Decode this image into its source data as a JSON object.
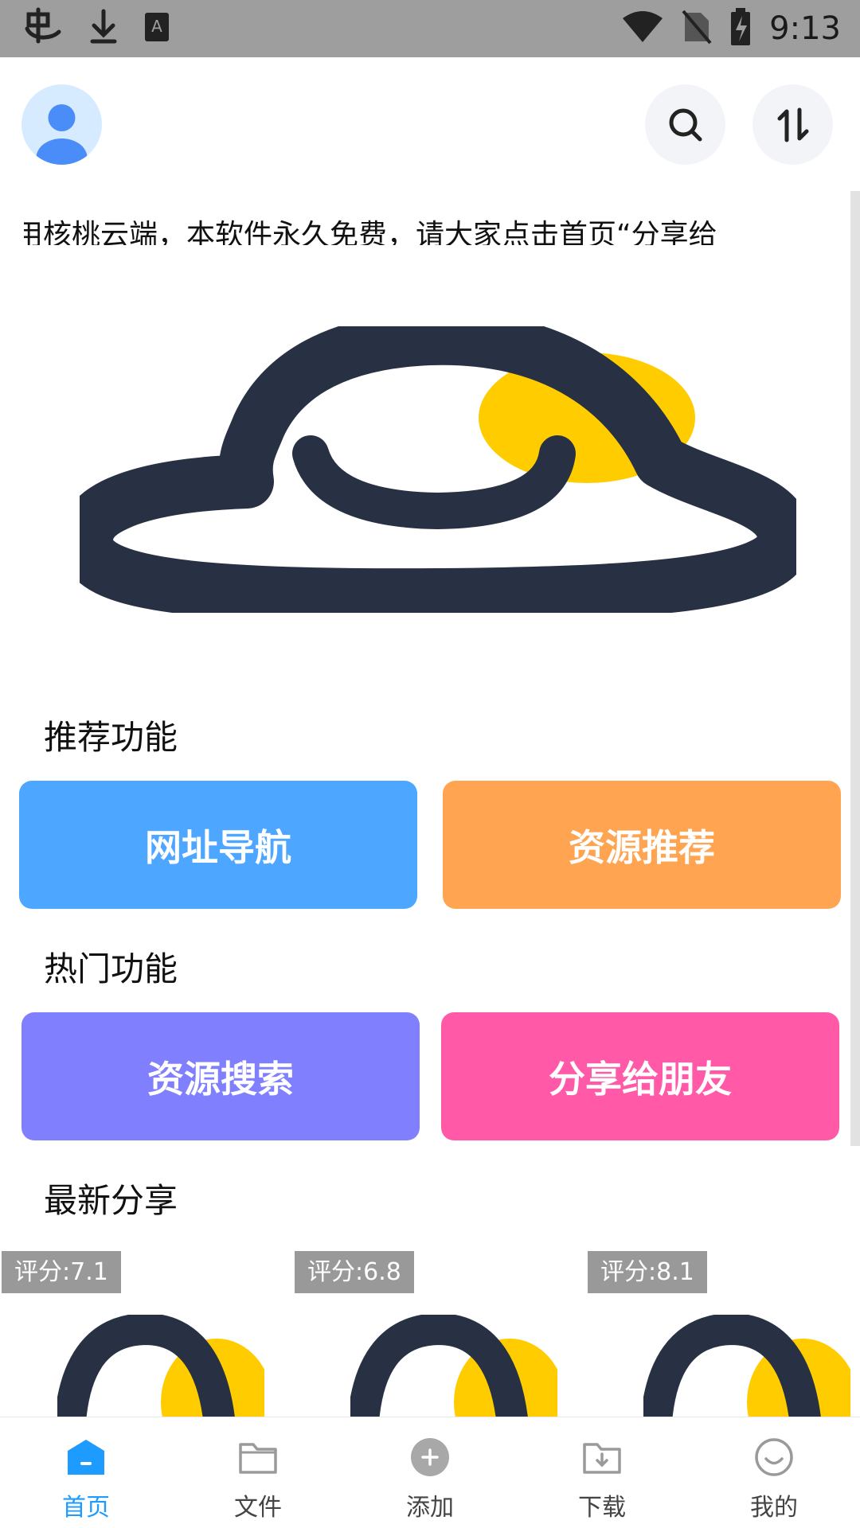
{
  "status_bar": {
    "time": "9:13",
    "left_icons": [
      "app-notification-icon",
      "download-icon",
      "keyboard-icon"
    ],
    "right_icons": [
      "wifi-icon",
      "no-sim-icon",
      "battery-charging-icon"
    ]
  },
  "header": {
    "avatar_icon": "user-avatar-icon",
    "search_icon": "search-icon",
    "sort_icon": "sort-transfer-icon"
  },
  "marquee": {
    "text": "用核桃云端，本软件永久免费，请大家点击首页“分享给"
  },
  "banner": {
    "icon": "cloud-logo-icon",
    "colors": {
      "cloud": "#283044",
      "sun": "#ffcc00"
    }
  },
  "sections": {
    "recommended": {
      "title": "推荐功能",
      "buttons": [
        {
          "label": "网址导航",
          "color": "#4da6ff"
        },
        {
          "label": "资源推荐",
          "color": "#ffa552"
        }
      ]
    },
    "popular": {
      "title": "热门功能",
      "buttons": [
        {
          "label": "资源搜索",
          "color": "#8080ff"
        },
        {
          "label": "分享给朋友",
          "color": "#ff59a8"
        }
      ]
    },
    "latest": {
      "title": "最新分享",
      "cards": [
        {
          "score": "评分:7.1"
        },
        {
          "score": "评分:6.8"
        },
        {
          "score": "评分:8.1"
        }
      ]
    }
  },
  "bottom_nav": {
    "active_color": "#1e9bff",
    "items": [
      {
        "label": "首页",
        "icon": "home-icon",
        "active": true
      },
      {
        "label": "文件",
        "icon": "folder-icon",
        "active": false
      },
      {
        "label": "添加",
        "icon": "add-icon",
        "active": false
      },
      {
        "label": "下载",
        "icon": "download-folder-icon",
        "active": false
      },
      {
        "label": "我的",
        "icon": "smile-icon",
        "active": false
      }
    ]
  }
}
